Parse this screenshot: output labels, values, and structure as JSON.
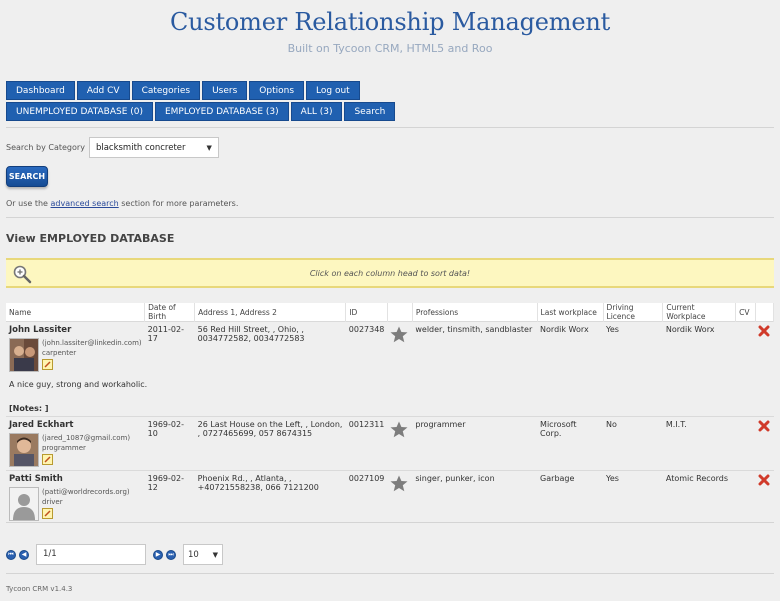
{
  "header": {
    "title": "Customer Relationship Management",
    "subtitle": "Built on Tycoon CRM, HTML5 and Roo"
  },
  "nav": {
    "row1": [
      "Dashboard",
      "Add CV",
      "Categories",
      "Users",
      "Options",
      "Log out"
    ],
    "row2": [
      "UNEMPLOYED DATABASE (0)",
      "EMPLOYED DATABASE (3)",
      "ALL (3)",
      "Search"
    ]
  },
  "search": {
    "label": "Search by Category",
    "selected_category": "blacksmith concreter",
    "button_label": "SEARCH",
    "adv_prefix": "Or use the",
    "adv_link": "advanced search",
    "adv_suffix": "section for more parameters."
  },
  "section_title": "View EMPLOYED DATABASE",
  "info_text": "Click on each column head to sort data!",
  "table": {
    "columns": [
      "Name",
      "Date of Birth",
      "Address 1, Address 2",
      "ID",
      "",
      "Professions",
      "Last workplace",
      "Driving Licence",
      "Current Workplace",
      "CV",
      ""
    ],
    "rows": [
      {
        "name": "John Lassiter",
        "email": "(john.lassiter@linkedin.com)",
        "job": "carpenter",
        "dob": "2011-02-17",
        "address": "56 Red Hill Street, , Ohio, , 0034772582, 0034772583",
        "id": "0027348",
        "professions": "welder, tinsmith, sandblaster",
        "last_workplace": "Nordik Worx",
        "driving": "Yes",
        "current_workplace": "Nordik Worx",
        "note": "A nice guy, strong and workaholic.",
        "notes_label": "[Notes: ]"
      },
      {
        "name": "Jared Eckhart",
        "email": "(jared_1087@gmail.com)",
        "job": "programmer",
        "dob": "1969-02-10",
        "address": "26 Last House on the Left, , London, , 0727465699, 057 8674315",
        "id": "0012311",
        "professions": "programmer",
        "last_workplace": "Microsoft Corp.",
        "driving": "No",
        "current_workplace": "M.I.T."
      },
      {
        "name": "Patti Smith",
        "email": "(patti@worldrecords.org)",
        "job": "driver",
        "dob": "1969-02-12",
        "address": "Phoenix Rd., , Atlanta, , +40721558238, 066 7121200",
        "id": "0027109",
        "professions": "singer, punker, icon",
        "last_workplace": "Garbage",
        "driving": "Yes",
        "current_workplace": "Atomic Records"
      }
    ]
  },
  "pager": {
    "page": "1/1",
    "rows_per_page": "10"
  },
  "footer": "Tycoon CRM v1.4.3",
  "colors": {
    "accent": "#2060b0",
    "title": "#2a5aa0",
    "info_bg": "#fdf7c0",
    "delete": "#d03a2a"
  }
}
